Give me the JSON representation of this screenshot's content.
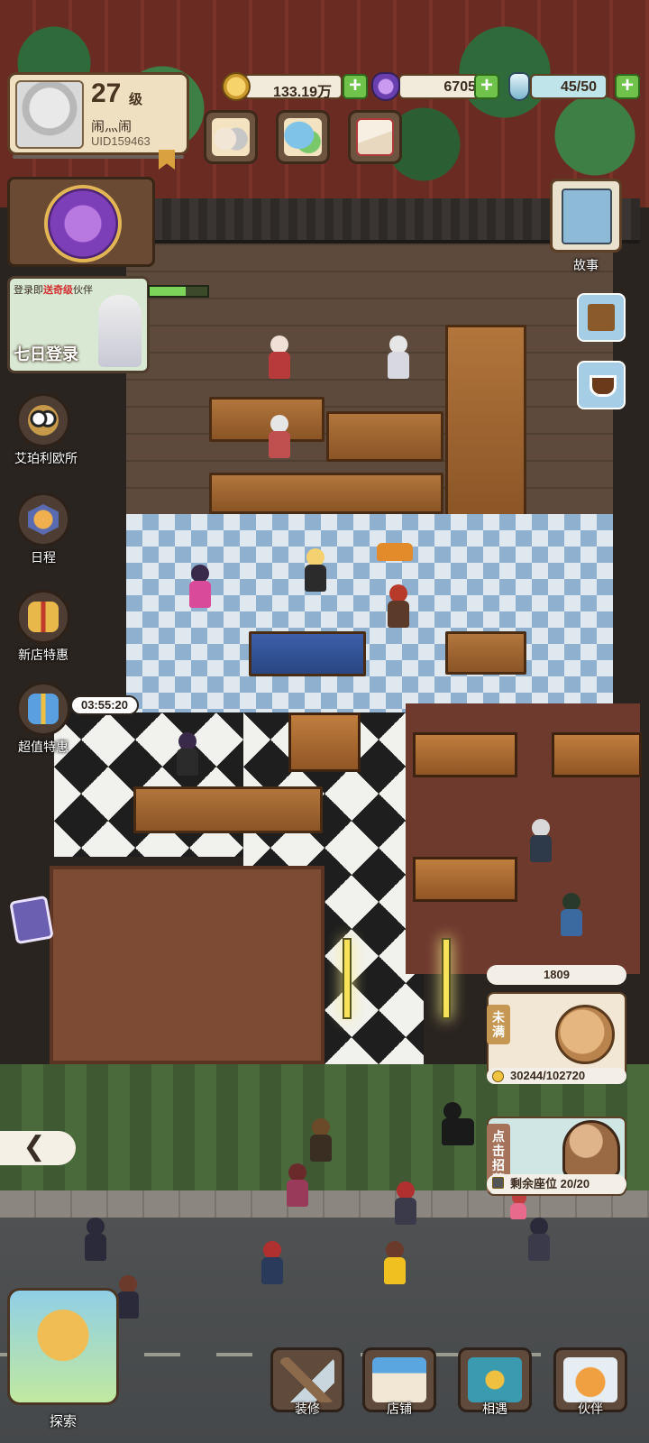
{
  "profile": {
    "level": "27",
    "level_unit": "级",
    "name": "闹灬闹",
    "uid": "UID159463"
  },
  "resources": {
    "coins": "133.19万",
    "gems": "6705",
    "stamina": "45/50",
    "plus": "+"
  },
  "left_menu": {
    "login_promo_prefix": "登录即",
    "login_promo_highlight": "送奇级",
    "login_promo_suffix": "伙伴",
    "login_title": "七日登录",
    "items": [
      {
        "label": "艾珀利欧所",
        "icon": "owl-icon"
      },
      {
        "label": "日程",
        "icon": "schedule-badge-icon"
      },
      {
        "label": "新店特惠",
        "icon": "gift-box-icon"
      },
      {
        "label": "超值特惠",
        "icon": "gift-blue-icon"
      }
    ],
    "timer": "03:55:20"
  },
  "story": {
    "label": "故事"
  },
  "back": {
    "label": "❮"
  },
  "shop_panel": {
    "seat_value": "1809",
    "not_full_label": "未满",
    "income_progress": "30244/102720",
    "recruit_label": "点击招募",
    "seats_remaining": "剩余座位 20/20"
  },
  "bottom_nav": {
    "explore": "探索",
    "items": [
      {
        "label": "装修",
        "icon": "hammer-icon"
      },
      {
        "label": "店铺",
        "icon": "shop-icon"
      },
      {
        "label": "相遇",
        "icon": "phone-icon"
      },
      {
        "label": "伙伴",
        "icon": "cat-card-icon"
      }
    ]
  },
  "colors": {
    "plus_green": "#6fc24a",
    "panel_beige": "#f3e7cf",
    "border_brown": "#5c3f25",
    "promo_red": "#d33131"
  }
}
